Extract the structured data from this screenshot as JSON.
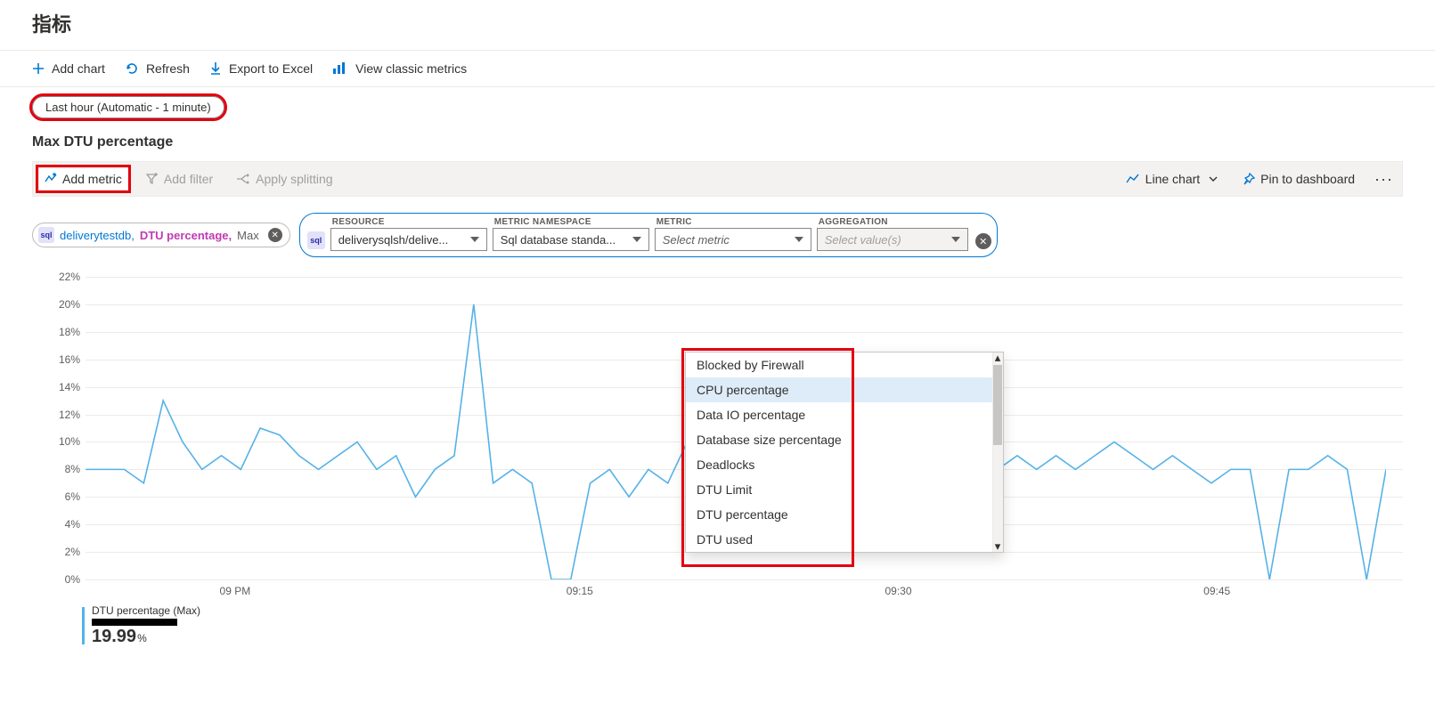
{
  "page_title": "指标",
  "toolbar": {
    "add_chart": "Add chart",
    "refresh": "Refresh",
    "export_excel": "Export to Excel",
    "view_classic": "View classic metrics"
  },
  "time_range": "Last hour (Automatic - 1 minute)",
  "chart_title": "Max DTU percentage",
  "metric_bar": {
    "add_metric": "Add metric",
    "add_filter": "Add filter",
    "apply_splitting": "Apply splitting",
    "chart_type": "Line chart",
    "pin": "Pin to dashboard"
  },
  "existing_pill": {
    "db": "deliverytestdb,",
    "metric": "DTU percentage,",
    "agg": "Max"
  },
  "selector": {
    "resource_label": "RESOURCE",
    "resource_value": "deliverysqlsh/delive...",
    "namespace_label": "METRIC NAMESPACE",
    "namespace_value": "Sql database standa...",
    "metric_label": "METRIC",
    "metric_value": "Select metric",
    "agg_label": "AGGREGATION",
    "agg_value": "Select value(s)"
  },
  "dropdown_items": [
    "Blocked by Firewall",
    "CPU percentage",
    "Data IO percentage",
    "Database size percentage",
    "Deadlocks",
    "DTU Limit",
    "DTU percentage",
    "DTU used"
  ],
  "dropdown_hover_index": 1,
  "legend": {
    "label": "DTU percentage (Max)",
    "value": "19.99",
    "unit": "%"
  },
  "chart_data": {
    "type": "line",
    "title": "Max DTU percentage",
    "xlabel": "",
    "ylabel": "",
    "ylim": [
      0,
      22
    ],
    "y_ticks": [
      "0%",
      "2%",
      "4%",
      "6%",
      "8%",
      "10%",
      "12%",
      "14%",
      "16%",
      "18%",
      "20%",
      "22%"
    ],
    "x_ticks": [
      "09 PM",
      "09:15",
      "09:30",
      "09:45"
    ],
    "series": [
      {
        "name": "DTU percentage (Max)",
        "color": "#55b2e8",
        "values": [
          8,
          8,
          8,
          7,
          13,
          10,
          8,
          9,
          8,
          11,
          10.5,
          9,
          8,
          9,
          10,
          8,
          9,
          6,
          8,
          9,
          20,
          7,
          8,
          7,
          0,
          0,
          7,
          8,
          6,
          8,
          7,
          10,
          8,
          9,
          9,
          9,
          10,
          9,
          8,
          9,
          10,
          9,
          9,
          8,
          9,
          9,
          9,
          8,
          9,
          8,
          9,
          8,
          9,
          10,
          9,
          8,
          9,
          8,
          7,
          8,
          8,
          0,
          8,
          8,
          9,
          8,
          0,
          8
        ]
      }
    ]
  }
}
